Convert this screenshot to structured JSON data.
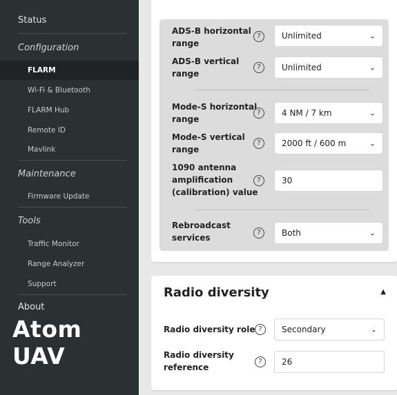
{
  "sidebar": {
    "status": "Status",
    "configuration": "Configuration",
    "flarm": "FLARM",
    "wifi": "Wi-Fi & Bluetooth",
    "flarm_hub": "FLARM Hub",
    "remote_id": "Remote ID",
    "mavlink": "Mavlink",
    "maintenance": "Maintenance",
    "firmware_update": "Firmware Update",
    "tools": "Tools",
    "traffic_monitor": "Traffic Monitor",
    "range_analyzer": "Range Analyzer",
    "support": "Support",
    "about": "About",
    "brand": "Atom UAV"
  },
  "range": {
    "adsb_h": {
      "label_1": "ADS-B horizontal",
      "label_2": "range",
      "value": "Unlimited"
    },
    "adsb_v": {
      "label_1": "ADS-B vertical",
      "label_2": "range",
      "value": "Unlimited"
    },
    "modes_h": {
      "label_1": "Mode-S horizontal",
      "label_2": "range",
      "value": "4 NM / 7 km"
    },
    "modes_v": {
      "label_1": "Mode-S vertical",
      "label_2": "range",
      "value": "2000 ft / 600 m"
    },
    "antenna": {
      "label_1": "1090 antenna",
      "label_2": "amplification",
      "label_3": "(calibration) value",
      "value": "30"
    },
    "rebroadcast": {
      "label_1": "Rebroadcast",
      "label_2": "services",
      "value": "Both"
    }
  },
  "radio_diversity": {
    "title": "Radio diversity",
    "role": {
      "label": "Radio diversity role",
      "value": "Secondary"
    },
    "reference": {
      "label_1": "Radio diversity",
      "label_2": "reference",
      "value": "26"
    }
  },
  "icons": {
    "help": "?",
    "chevron": "⌄",
    "collapse": "▲"
  }
}
